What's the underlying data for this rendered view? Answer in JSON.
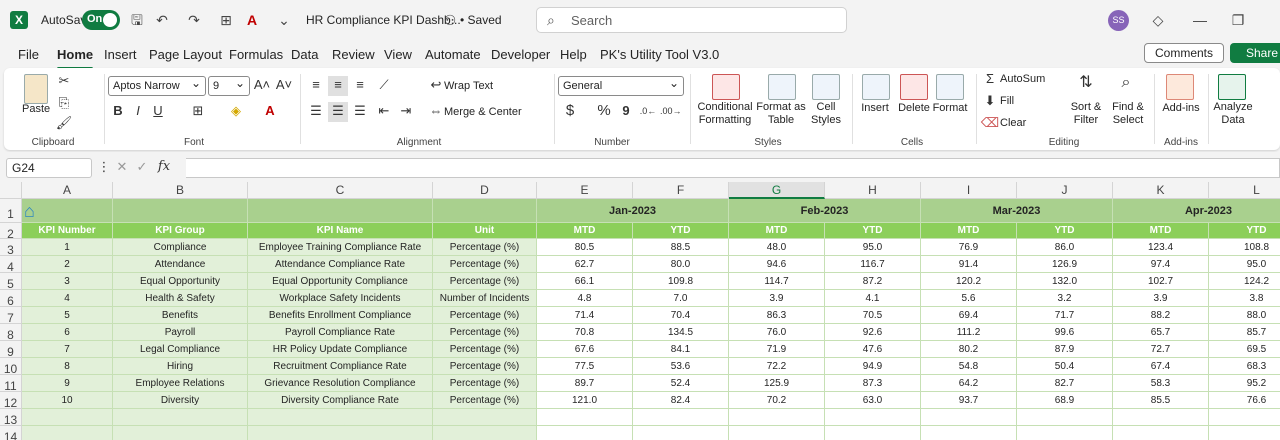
{
  "titlebar": {
    "autosave_label": "AutoSave",
    "autosave_state": "On",
    "doc_title": "HR Compliance KPI Dashb...",
    "saved_status": "• Saved",
    "search_placeholder": "Search",
    "user_initials": "SS"
  },
  "menu": [
    "File",
    "Home",
    "Insert",
    "Page Layout",
    "Formulas",
    "Data",
    "Review",
    "View",
    "Automate",
    "Developer",
    "Help",
    "PK's Utility Tool V3.0"
  ],
  "menu_active": "Home",
  "top_buttons": {
    "comments": "Comments",
    "share": "Share"
  },
  "ribbon": {
    "clipboard": {
      "paste": "Paste",
      "label": "Clipboard"
    },
    "font": {
      "name": "Aptos Narrow",
      "size": "9",
      "label": "Font",
      "bold": "B",
      "italic": "I",
      "underline": "U"
    },
    "alignment": {
      "wrap": "Wrap Text",
      "merge": "Merge & Center",
      "label": "Alignment"
    },
    "number": {
      "format": "General",
      "label": "Number",
      "currency": "$",
      "percent": "%",
      "comma": "9"
    },
    "styles": {
      "conditional": "Conditional",
      "conditional2": "Formatting",
      "format_table": "Format as",
      "format_table2": "Table",
      "cell_styles": "Cell",
      "cell_styles2": "Styles",
      "label": "Styles"
    },
    "cells": {
      "insert": "Insert",
      "delete": "Delete",
      "format": "Format",
      "label": "Cells"
    },
    "editing": {
      "autosum": "AutoSum",
      "fill": "Fill",
      "clear": "Clear",
      "sort": "Sort &",
      "sort2": "Filter",
      "find": "Find &",
      "find2": "Select",
      "label": "Editing"
    },
    "addins": {
      "addins": "Add-ins",
      "label": "Add-ins"
    },
    "analyze": {
      "line1": "Analyze",
      "line2": "Data"
    }
  },
  "formula_bar": {
    "name_box": "G24",
    "fx": "fx"
  },
  "colors": {
    "header_green": "#8ccf5a",
    "month_green": "#a9d08e",
    "body_green": "#e2f0d9",
    "accent": "#107c41"
  },
  "columns": [
    "A",
    "B",
    "C",
    "D",
    "E",
    "F",
    "G",
    "H",
    "I",
    "J",
    "K",
    "L"
  ],
  "row_numbers": [
    "1",
    "2",
    "3",
    "4",
    "5",
    "6",
    "7",
    "8",
    "9",
    "10",
    "11",
    "12",
    "13",
    "14"
  ],
  "months": [
    "Jan-2023",
    "Feb-2023",
    "Mar-2023",
    "Apr-2023"
  ],
  "headers": [
    "KPI Number",
    "KPI Group",
    "KPI Name",
    "Unit",
    "MTD",
    "YTD",
    "MTD",
    "YTD",
    "MTD",
    "YTD",
    "MTD",
    "YTD"
  ],
  "rows": [
    [
      "1",
      "Compliance",
      "Employee Training Compliance Rate",
      "Percentage (%)",
      "80.5",
      "88.5",
      "48.0",
      "95.0",
      "76.9",
      "86.0",
      "123.4",
      "108.8"
    ],
    [
      "2",
      "Attendance",
      "Attendance Compliance Rate",
      "Percentage (%)",
      "62.7",
      "80.0",
      "94.6",
      "116.7",
      "91.4",
      "126.9",
      "97.4",
      "95.0"
    ],
    [
      "3",
      "Equal Opportunity",
      "Equal Opportunity Compliance",
      "Percentage (%)",
      "66.1",
      "109.8",
      "114.7",
      "87.2",
      "120.2",
      "132.0",
      "102.7",
      "124.2"
    ],
    [
      "4",
      "Health & Safety",
      "Workplace Safety Incidents",
      "Number of Incidents",
      "4.8",
      "7.0",
      "3.9",
      "4.1",
      "5.6",
      "3.2",
      "3.9",
      "3.8"
    ],
    [
      "5",
      "Benefits",
      "Benefits Enrollment Compliance",
      "Percentage (%)",
      "71.4",
      "70.4",
      "86.3",
      "70.5",
      "69.4",
      "71.7",
      "88.2",
      "88.0"
    ],
    [
      "6",
      "Payroll",
      "Payroll Compliance Rate",
      "Percentage (%)",
      "70.8",
      "134.5",
      "76.0",
      "92.6",
      "111.2",
      "99.6",
      "65.7",
      "85.7"
    ],
    [
      "7",
      "Legal Compliance",
      "HR Policy Update Compliance",
      "Percentage (%)",
      "67.6",
      "84.1",
      "71.9",
      "47.6",
      "80.2",
      "87.9",
      "72.7",
      "69.5"
    ],
    [
      "8",
      "Hiring",
      "Recruitment Compliance Rate",
      "Percentage (%)",
      "77.5",
      "53.6",
      "72.2",
      "94.9",
      "54.8",
      "50.4",
      "67.4",
      "68.3"
    ],
    [
      "9",
      "Employee Relations",
      "Grievance Resolution Compliance",
      "Percentage (%)",
      "89.7",
      "52.4",
      "125.9",
      "87.3",
      "64.2",
      "82.7",
      "58.3",
      "95.2"
    ],
    [
      "10",
      "Diversity",
      "Diversity Compliance Rate",
      "Percentage (%)",
      "121.0",
      "82.4",
      "70.2",
      "63.0",
      "93.7",
      "68.9",
      "85.5",
      "76.6"
    ]
  ]
}
